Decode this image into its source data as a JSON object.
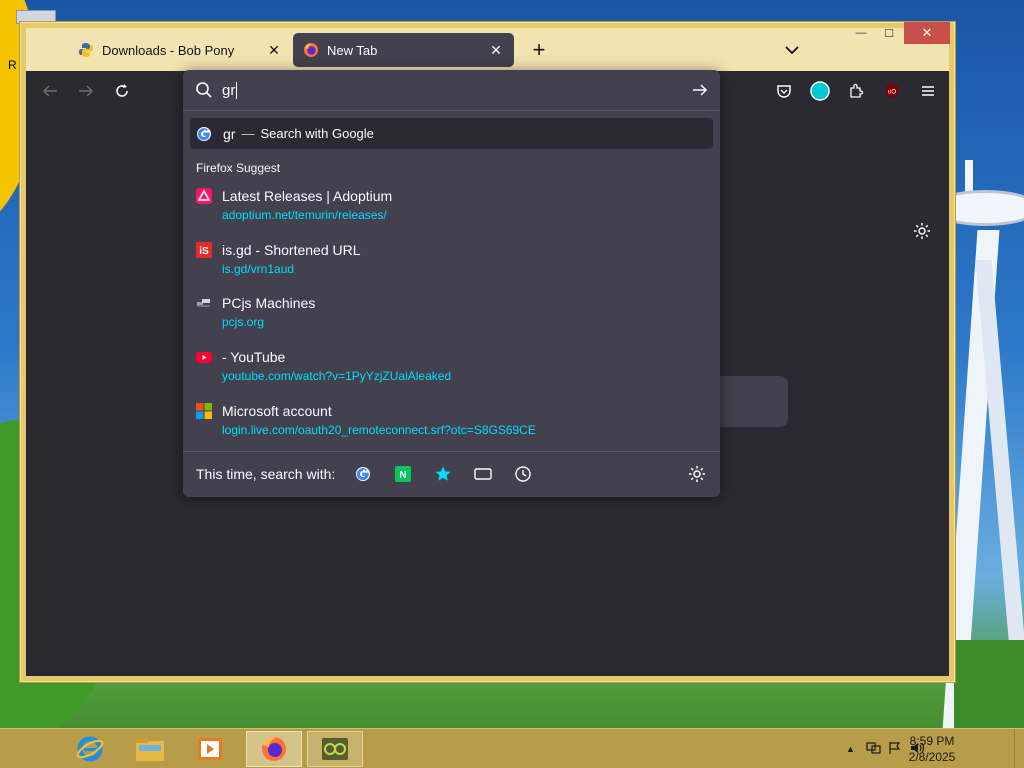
{
  "desktop": {
    "label_fragment": "R"
  },
  "browser": {
    "tabs": [
      {
        "title": "Downloads - Bob Pony",
        "close": "✕",
        "active": false
      },
      {
        "title": "New Tab",
        "close": "✕",
        "active": true
      }
    ],
    "new_tab": "+",
    "window_controls": {
      "minimize": "—",
      "maximize": "☐",
      "close": "✕"
    }
  },
  "urlbar": {
    "input_value": "gr",
    "heuristic": {
      "query": "gr",
      "dash": "—",
      "action": "Search with Google"
    },
    "group_label": "Firefox Suggest",
    "suggestions": [
      {
        "title": "Latest Releases | Adoptium",
        "url": "adoptium.net/temurin/releases/",
        "icon": "adoptium-icon"
      },
      {
        "title": "is.gd - Shortened URL",
        "url": "is.gd/vrn1aud",
        "icon": "isgd-icon"
      },
      {
        "title": "PCjs Machines",
        "url": "pcjs.org",
        "icon": "pcjs-icon"
      },
      {
        "title": "- YouTube",
        "url": "youtube.com/watch?v=1PyYzjZUaiAleaked",
        "icon": "youtube-icon"
      },
      {
        "title": "Microsoft account",
        "url": "login.live.com/oauth20_remoteconnect.srf?otc=S8GS69CE",
        "icon": "microsoft-icon"
      }
    ],
    "oneoff_label": "This time, search with:"
  },
  "taskbar": {
    "clock_time": "8:59 PM",
    "clock_date": "2/8/2025"
  },
  "colors": {
    "accent": "#00ddff",
    "toolbar": "#2b2a33",
    "popup": "#42414d",
    "window_frame": "#e5c96a",
    "taskbar": "#b79c4a"
  }
}
